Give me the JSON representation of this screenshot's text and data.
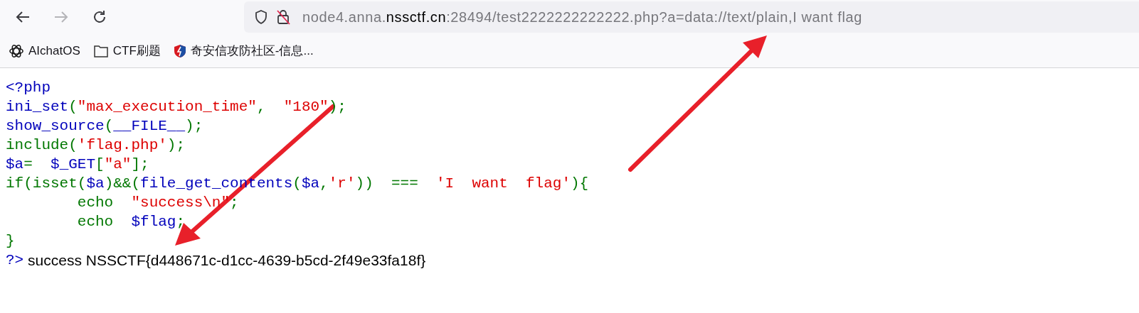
{
  "toolbar": {
    "buttons": [
      {
        "kind": "back",
        "disabled": false
      },
      {
        "kind": "forward",
        "disabled": true
      },
      {
        "kind": "reload",
        "disabled": false
      }
    ],
    "url_parts": [
      {
        "text": "node4.anna.",
        "emphasis": false
      },
      {
        "text": "nssctf.cn",
        "emphasis": true
      },
      {
        "text": ":28494/test2222222222222.php?a=data://text/plain,I want flag",
        "emphasis": false
      }
    ]
  },
  "bookmarks": [
    {
      "kind": "chat",
      "label": "AIchatOS"
    },
    {
      "kind": "folder",
      "label": "CTF刷题"
    },
    {
      "kind": "shield",
      "label": "奇安信攻防社区-信息..."
    }
  ],
  "source_lines": [
    [
      {
        "kind": "default",
        "text": "<?php"
      }
    ],
    [
      {
        "kind": "default",
        "text": "ini_set"
      },
      {
        "kind": "keyword",
        "text": "("
      },
      {
        "kind": "string",
        "text": "\"max_execution_time\""
      },
      {
        "kind": "keyword",
        "text": ",  "
      },
      {
        "kind": "string",
        "text": "\"180\""
      },
      {
        "kind": "keyword",
        "text": ");"
      }
    ],
    [
      {
        "kind": "default",
        "text": "show_source"
      },
      {
        "kind": "keyword",
        "text": "("
      },
      {
        "kind": "default",
        "text": "__FILE__"
      },
      {
        "kind": "keyword",
        "text": ");"
      }
    ],
    [
      {
        "kind": "keyword",
        "text": "include("
      },
      {
        "kind": "string",
        "text": "'flag.php'"
      },
      {
        "kind": "keyword",
        "text": ");"
      }
    ],
    [
      {
        "kind": "default",
        "text": "$a"
      },
      {
        "kind": "keyword",
        "text": "=  "
      },
      {
        "kind": "default",
        "text": "$_GET"
      },
      {
        "kind": "keyword",
        "text": "["
      },
      {
        "kind": "string",
        "text": "\"a\""
      },
      {
        "kind": "keyword",
        "text": "];"
      }
    ],
    [
      {
        "kind": "keyword",
        "text": "if(isset("
      },
      {
        "kind": "default",
        "text": "$a"
      },
      {
        "kind": "keyword",
        "text": ")&&("
      },
      {
        "kind": "default",
        "text": "file_get_contents"
      },
      {
        "kind": "keyword",
        "text": "("
      },
      {
        "kind": "default",
        "text": "$a"
      },
      {
        "kind": "keyword",
        "text": ","
      },
      {
        "kind": "string",
        "text": "'r'"
      },
      {
        "kind": "keyword",
        "text": "))  ===  "
      },
      {
        "kind": "string",
        "text": "'I  want  flag'"
      },
      {
        "kind": "keyword",
        "text": "){"
      }
    ],
    [
      {
        "kind": "keyword",
        "text": "        echo  "
      },
      {
        "kind": "string",
        "text": "\"success\\n\""
      },
      {
        "kind": "keyword",
        "text": ";"
      }
    ],
    [
      {
        "kind": "keyword",
        "text": "        echo  "
      },
      {
        "kind": "default",
        "text": "$flag"
      },
      {
        "kind": "keyword",
        "text": ";"
      }
    ],
    [
      {
        "kind": "keyword",
        "text": "}"
      }
    ],
    [
      {
        "kind": "default",
        "text": "?>"
      },
      {
        "kind": "html",
        "text": " success NSSCTF{d448671c-d1cc-4639-b5cd-2f49e33fa18f}"
      }
    ]
  ]
}
